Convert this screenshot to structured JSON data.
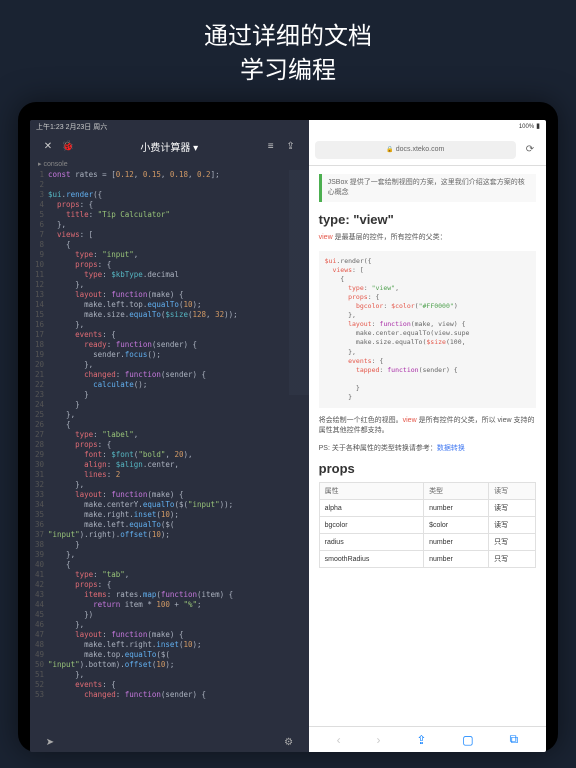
{
  "hero": {
    "line1": "通过详细的文档",
    "line2": "学习编程"
  },
  "status": {
    "time": "上午1:23  2月23日 周六",
    "battery": "100%"
  },
  "editor": {
    "title": "小费计算器 ▾",
    "tab": "▸ console",
    "lines": [
      "const rates = [0.12, 0.15, 0.18, 0.2];",
      "",
      "$ui.render({",
      "  props: {",
      "    title: \"Tip Calculator\"",
      "  },",
      "  views: [",
      "    {",
      "      type: \"input\",",
      "      props: {",
      "        type: $kbType.decimal",
      "      },",
      "      layout: function(make) {",
      "        make.left.top.equalTo(10);",
      "        make.size.equalTo($size(128, 32));",
      "      },",
      "      events: {",
      "        ready: function(sender) {",
      "          sender.focus();",
      "        },",
      "        changed: function(sender) {",
      "          calculate();",
      "        }",
      "      }",
      "    },",
      "    {",
      "      type: \"label\",",
      "      props: {",
      "        font: $font(\"bold\", 20),",
      "        align: $align.center,",
      "        lines: 2",
      "      },",
      "      layout: function(make) {",
      "        make.centerY.equalTo($(\"input\"));",
      "        make.right.inset(10);",
      "        make.left.equalTo($(",
      "\"input\").right).offset(10);",
      "      }",
      "    },",
      "    {",
      "      type: \"tab\",",
      "      props: {",
      "        items: rates.map(function(item) {",
      "          return item * 100 + \"%\";",
      "        })",
      "      },",
      "      layout: function(make) {",
      "        make.left.right.inset(10);",
      "        make.top.equalTo($(",
      "\"input\").bottom).offset(10);",
      "      },",
      "      events: {",
      "        changed: function(sender) {"
    ]
  },
  "browser": {
    "url": "docs.xteko.com",
    "quote": "JSBox 提供了一套绘制视图的方案，这里我们介绍这套方案的核心概念",
    "h2_type": "type: \"view\"",
    "p1_pre": "view",
    "p1": " 是最基层的控件，所有控件的父类：",
    "code": "$ui.render({\n  views: [\n    {\n      type: \"view\",\n      props: {\n        bgcolor: $color(\"#FF0000\")\n      },\n      layout: function(make, view) {\n        make.center.equalTo(view.supe\n        make.size.equalTo($size(100,\n      },\n      events: {\n        tapped: function(sender) {\n\n        }\n      }",
    "p2_a": "将会绘制一个红色的视图。",
    "p2_b": "view",
    "p2_c": " 是所有控件的父类，所以 view 支持的属性其他控件都支持。",
    "p3_a": "PS: 关于各种属性的类型转换请参考：",
    "p3_b": "数据转换",
    "h2_props": "props",
    "table": {
      "headers": [
        "属性",
        "类型",
        "读写"
      ],
      "rows": [
        [
          "alpha",
          "number",
          "读写"
        ],
        [
          "bgcolor",
          "$color",
          "读写"
        ],
        [
          "radius",
          "number",
          "只写"
        ],
        [
          "smoothRadius",
          "number",
          "只写"
        ]
      ]
    }
  }
}
